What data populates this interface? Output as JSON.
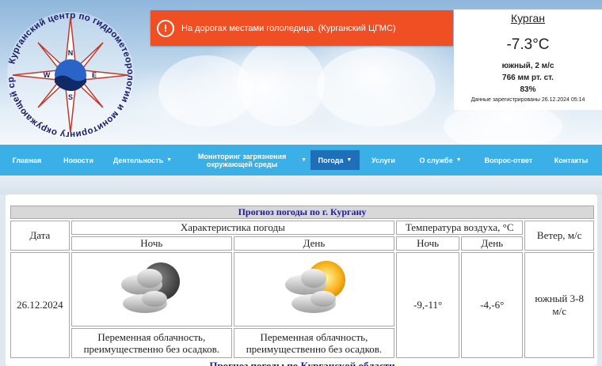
{
  "header": {
    "logo": {
      "ring_text": "Курганский центр по гидрометеорологии и мониторингу окружающей среды",
      "compass": [
        "N",
        "W",
        "E",
        "S"
      ]
    },
    "alert": {
      "icon": "alert-circle-icon",
      "text": "На дорогах местами гололедица. (Курганский ЦГМС)"
    },
    "current_weather": {
      "city": "Курган",
      "temperature": "-7.3°C",
      "wind": "южный, 2 м/с",
      "pressure": "766 мм рт. ст.",
      "humidity": "83%",
      "note": "Данные зарегистрированы 26.12.2024 05:14"
    }
  },
  "nav": {
    "items": [
      {
        "label": "Главная",
        "dropdown": false,
        "active": false
      },
      {
        "label": "Новости",
        "dropdown": false,
        "active": false
      },
      {
        "label": "Деятельность",
        "dropdown": true,
        "active": false
      },
      {
        "label": "Мониторинг загрязнения окружающей среды",
        "dropdown": true,
        "active": false
      },
      {
        "label": "Погода",
        "dropdown": true,
        "active": true
      },
      {
        "label": "Услуги",
        "dropdown": false,
        "active": false
      },
      {
        "label": "О службе",
        "dropdown": true,
        "active": false
      },
      {
        "label": "Вопрос-ответ",
        "dropdown": false,
        "active": false
      },
      {
        "label": "Контакты",
        "dropdown": false,
        "active": false
      }
    ]
  },
  "forecast": {
    "title": "Прогноз погоды по г. Кургану",
    "headers": {
      "date": "Дата",
      "characteristic": "Характеристика погоды",
      "temperature": "Температура воздуха, °C",
      "wind": "Ветер, м/с",
      "night": "Ночь",
      "day": "День"
    },
    "rows": [
      {
        "date": "26.12.2024",
        "night_icon": "partly-cloudy-night-icon",
        "day_icon": "partly-cloudy-day-icon",
        "night_desc": "Переменная облачность, преимущественно без осадков.",
        "day_desc": "Переменная облачность, преимущественно без осадков.",
        "temp_night": "-9,-11°",
        "temp_day": "-4,-6°",
        "wind": "южный 3-8 м/с"
      }
    ],
    "next_title": "Прогноз погоды по Курганской области"
  },
  "colors": {
    "nav_bg": "#3ab0e6",
    "nav_active": "#1f6fb8",
    "alert_bg": "#f04e23",
    "title_color": "#1a1aa0"
  }
}
